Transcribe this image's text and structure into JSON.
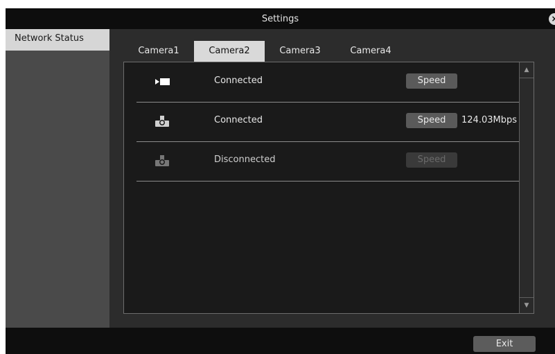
{
  "window": {
    "title": "Settings",
    "close_icon": "close-icon"
  },
  "sidebar": {
    "items": [
      {
        "label": "Network Status",
        "selected": true
      }
    ]
  },
  "tabs": [
    {
      "label": "Camera1",
      "active": false
    },
    {
      "label": "Camera2",
      "active": true
    },
    {
      "label": "Camera3",
      "active": false
    },
    {
      "label": "Camera4",
      "active": false
    }
  ],
  "connections": [
    {
      "icon": "video-camera-icon",
      "status": "Connected",
      "speed_label": "Speed",
      "speed_value": "",
      "enabled": true
    },
    {
      "icon": "network-upload-icon",
      "status": "Connected",
      "speed_label": "Speed",
      "speed_value": "124.03Mbps ps",
      "enabled": true
    },
    {
      "icon": "network-upload-icon",
      "status": "Disconnected",
      "speed_label": "Speed",
      "speed_value": "",
      "enabled": false
    }
  ],
  "footer": {
    "exit_label": "Exit"
  },
  "colors": {
    "tab_active": "#d9d9d9",
    "sidebar_selected": "#d6d6d6",
    "button": "#5a5a5a"
  }
}
